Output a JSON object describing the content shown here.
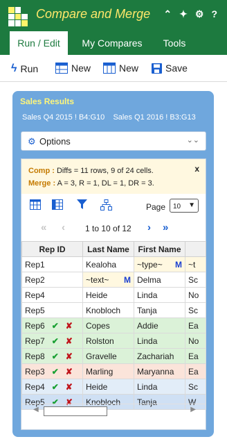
{
  "app": {
    "title": "Compare and Merge"
  },
  "tabs": [
    {
      "label": "Run / Edit",
      "active": true
    },
    {
      "label": "My Compares",
      "active": false
    },
    {
      "label": "Tools",
      "active": false
    }
  ],
  "toolbar": {
    "run": "Run",
    "new1": "New",
    "new2": "New",
    "save": "Save"
  },
  "panel": {
    "title": "Sales Results",
    "ranges": "Sales Q4 2015 ! B4:G10    Sales Q1 2016 ! B3:G13",
    "options_label": "Options"
  },
  "summary": {
    "comp_label": "Comp :",
    "comp_text": " Diffs = 11 rows, 9 of 24 cells.",
    "merge_label": "Merge :",
    "merge_text": " A = 3, R = 1, DL = 1, DR = 3.",
    "close": "x"
  },
  "pager": {
    "page_label": "Page",
    "page_size": "10",
    "range_text": "1 to 10 of 12"
  },
  "grid": {
    "headers": [
      "Rep ID",
      "Last Name",
      "First Name",
      ""
    ],
    "rows": [
      {
        "id": "Rep1",
        "last": "Kealoha",
        "first": "~type~",
        "extra": "~t",
        "style": ""
      },
      {
        "id": "Rep2",
        "last": "~text~",
        "first": "Delma",
        "extra": "Sc",
        "style": ""
      },
      {
        "id": "Rep4",
        "last": "Heide",
        "first": "Linda",
        "extra": "No",
        "style": ""
      },
      {
        "id": "Rep5",
        "last": "Knobloch",
        "first": "Tanja",
        "extra": "Sc",
        "style": ""
      },
      {
        "id": "Rep6",
        "last": "Copes",
        "first": "Addie",
        "extra": "Ea",
        "style": "del"
      },
      {
        "id": "Rep7",
        "last": "Rolston",
        "first": "Linda",
        "extra": "No",
        "style": "del"
      },
      {
        "id": "Rep8",
        "last": "Gravelle",
        "first": "Zachariah",
        "extra": "Ea",
        "style": "del"
      },
      {
        "id": "Rep3",
        "last": "Marling",
        "first": "Maryanna",
        "extra": "Ea",
        "style": "mod"
      },
      {
        "id": "Rep4",
        "last": "Heide",
        "first": "Linda",
        "extra": "Sc",
        "style": "add"
      },
      {
        "id": "Rep5",
        "last": "Knobloch",
        "first": "Tanja",
        "extra": "W",
        "style": "sel"
      }
    ],
    "m_marker": "M"
  },
  "colors": {
    "header_green": "#1d7a3f",
    "title_yellow": "#ffe76a",
    "panel_blue": "#6fa7dd",
    "accent_blue": "#1a5fd0",
    "summary_label": "#c47a00",
    "check_green": "#1aa033",
    "cross_red": "#c0161d"
  }
}
